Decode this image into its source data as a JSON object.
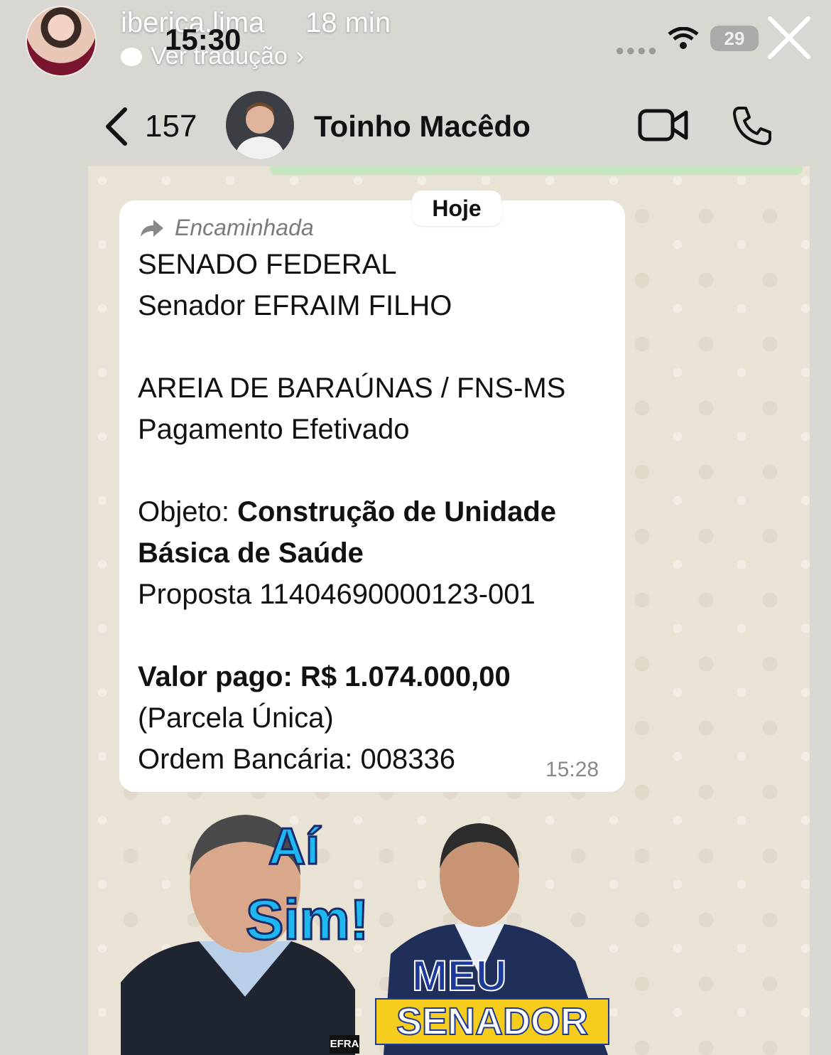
{
  "story": {
    "username": "iberica.lima",
    "elapsed": "18 min",
    "translate_label": "Ver tradução"
  },
  "status_bar": {
    "time": "15:30",
    "battery": "29"
  },
  "chat_header": {
    "back_count": "157",
    "contact_name": "Toinho Macêdo"
  },
  "message": {
    "day_chip": "Hoje",
    "forwarded_label": "Encaminhada",
    "line1": "SENADO FEDERAL",
    "line2": "Senador EFRAIM FILHO",
    "line3": "AREIA DE BARAÚNAS / FNS-MS",
    "line4": "Pagamento Efetivado",
    "objeto_label": "Objeto: ",
    "objeto_value_1": "Construção de Unidade",
    "objeto_value_2": "Básica de Saúde",
    "proposta": "Proposta 11404690000123-001",
    "valor": "Valor pago: R$ 1.074.000,00",
    "parcela": "(Parcela Única)",
    "ordem": "Ordem Bancária: 008336",
    "time": "15:28"
  },
  "campaign": {
    "ai": "Aí",
    "sim": "Sim!",
    "meu": "MEU",
    "senador": "SENADOR",
    "tag": "EFRA"
  }
}
